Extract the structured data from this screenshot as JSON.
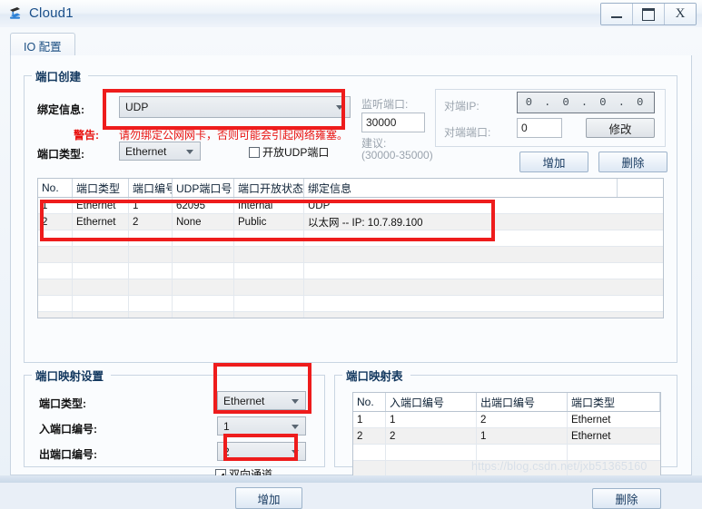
{
  "window": {
    "title": "Cloud1",
    "icon": "cloud-hub-icon",
    "controls": {
      "minimize": "minimize-icon",
      "maximize": "maximize-icon",
      "close": "X"
    }
  },
  "tab": {
    "label": "IO 配置"
  },
  "port_creation": {
    "title": "端口创建",
    "binding_label": "绑定信息:",
    "binding_value": "UDP",
    "warning_label": "警告:",
    "warning_text": "请勿绑定公网网卡，否则可能会引起网络雍塞。",
    "port_type_label": "端口类型:",
    "port_type_value": "Ethernet",
    "open_udp_label": "开放UDP端口",
    "open_udp_checked": false,
    "listen_port_label": "监听端口:",
    "listen_port_value": "30000",
    "suggest_label": "建议:",
    "suggest_range": "(30000-35000)",
    "peer_ip_label": "对端IP:",
    "peer_ip_value": "0 . 0 . 0 . 0",
    "peer_port_label": "对端端口:",
    "peer_port_value": "0",
    "modify_button": "修改",
    "add_button": "增加",
    "delete_button": "删除"
  },
  "port_table": {
    "columns": [
      "No.",
      "端口类型",
      "端口编号",
      "UDP端口号",
      "端口开放状态",
      "绑定信息"
    ],
    "rows": [
      {
        "no": "1",
        "type": "Ethernet",
        "number": "1",
        "udp": "62095",
        "status": "Internal",
        "binding": "UDP"
      },
      {
        "no": "2",
        "type": "Ethernet",
        "number": "2",
        "udp": "None",
        "status": "Public",
        "binding": "以太网 -- IP: 10.7.89.100"
      }
    ],
    "empty_rows": 6
  },
  "mapping_settings": {
    "title": "端口映射设置",
    "port_type_label": "端口类型:",
    "port_type_value": "Ethernet",
    "in_port_label": "入端口编号:",
    "in_port_value": "1",
    "out_port_label": "出端口编号:",
    "out_port_value": "2",
    "bidirectional_label": "双向通道",
    "bidirectional_checked": true,
    "add_button": "增加"
  },
  "mapping_table": {
    "title": "端口映射表",
    "columns": [
      "No.",
      "入端口编号",
      "出端口编号",
      "端口类型"
    ],
    "rows": [
      {
        "no": "1",
        "in": "1",
        "out": "2",
        "type": "Ethernet"
      },
      {
        "no": "2",
        "in": "2",
        "out": "1",
        "type": "Ethernet"
      }
    ],
    "empty_rows": 3,
    "delete_button": "删除"
  },
  "watermark": "https://blog.csdn.net/jxb51365160",
  "annotations": {
    "accent_color": "#ee1c1c"
  }
}
